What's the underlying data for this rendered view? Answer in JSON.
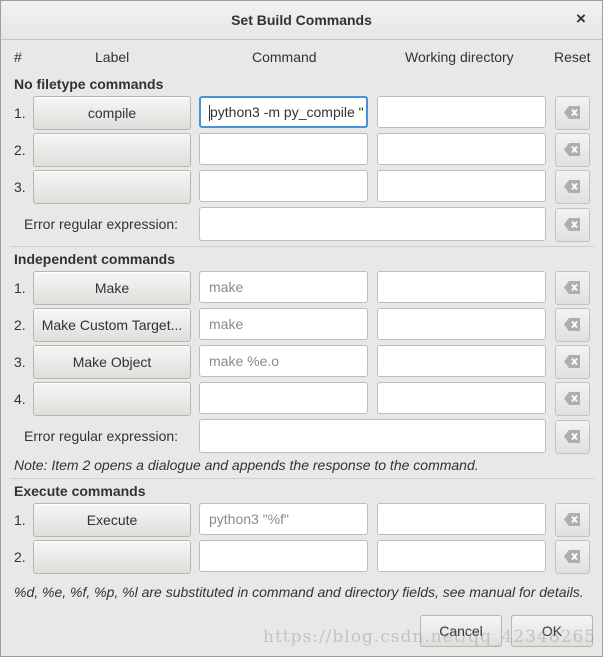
{
  "window": {
    "title": "Set Build Commands",
    "close_glyph": "×"
  },
  "columns": {
    "hash": "#",
    "label": "Label",
    "command": "Command",
    "working_dir": "Working directory",
    "reset": "Reset"
  },
  "filetype": {
    "heading": "No filetype commands",
    "rows": [
      {
        "num": "1.",
        "label": "compile",
        "command": "python3 -m py_compile \"",
        "working_dir": ""
      },
      {
        "num": "2.",
        "label": "",
        "command": "",
        "working_dir": ""
      },
      {
        "num": "3.",
        "label": "",
        "command": "",
        "working_dir": ""
      }
    ],
    "regex_label": "Error regular expression:",
    "regex_value": ""
  },
  "independent": {
    "heading": "Independent commands",
    "rows": [
      {
        "num": "1.",
        "label": "Make",
        "command": "make",
        "working_dir": ""
      },
      {
        "num": "2.",
        "label": "Make Custom Target...",
        "command": "make",
        "working_dir": ""
      },
      {
        "num": "3.",
        "label": "Make Object",
        "command": "make %e.o",
        "working_dir": ""
      },
      {
        "num": "4.",
        "label": "",
        "command": "",
        "working_dir": ""
      }
    ],
    "regex_label": "Error regular expression:",
    "regex_value": "",
    "note": "Note: Item 2 opens a dialogue and appends the response to the command."
  },
  "execute": {
    "heading": "Execute commands",
    "rows": [
      {
        "num": "1.",
        "label": "Execute",
        "command": "python3 \"%f\"",
        "working_dir": ""
      },
      {
        "num": "2.",
        "label": "",
        "command": "",
        "working_dir": ""
      }
    ]
  },
  "footer_note": "%d, %e, %f, %p, %l are substituted in command and directory fields, see manual for details.",
  "buttons": {
    "cancel": "Cancel",
    "ok": "OK"
  },
  "watermark": "https://blog.csdn.net/qq_42348265",
  "icons": {
    "reset": "clear-icon",
    "close": "close-icon"
  },
  "colors": {
    "focus_ring": "#4a90d9",
    "dialog_bg": "#e8e8e7"
  }
}
